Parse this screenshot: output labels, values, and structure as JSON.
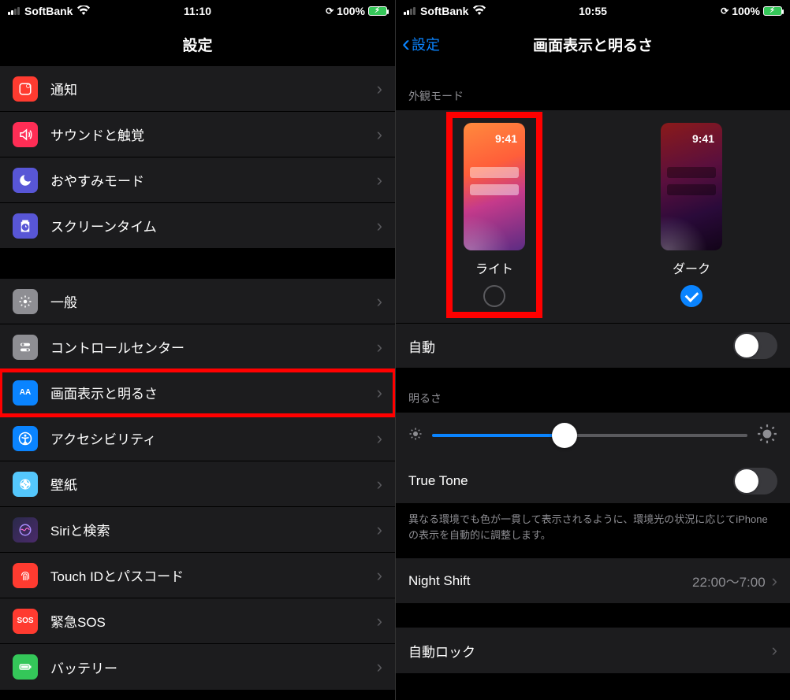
{
  "left": {
    "status": {
      "carrier": "SoftBank",
      "time": "11:10",
      "battery": "100%"
    },
    "title": "設定",
    "group1": [
      {
        "label": "通知"
      },
      {
        "label": "サウンドと触覚"
      },
      {
        "label": "おやすみモード"
      },
      {
        "label": "スクリーンタイム"
      }
    ],
    "group2": [
      {
        "label": "一般"
      },
      {
        "label": "コントロールセンター"
      },
      {
        "label": "画面表示と明るさ"
      },
      {
        "label": "アクセシビリティ"
      },
      {
        "label": "壁紙"
      },
      {
        "label": "Siriと検索"
      },
      {
        "label": "Touch IDとパスコード"
      },
      {
        "label": "緊急SOS"
      },
      {
        "label": "バッテリー"
      }
    ]
  },
  "right": {
    "status": {
      "carrier": "SoftBank",
      "time": "10:55",
      "battery": "100%"
    },
    "back": "設定",
    "title": "画面表示と明るさ",
    "appearance_header": "外観モード",
    "preview_time": "9:41",
    "light_label": "ライト",
    "dark_label": "ダーク",
    "auto_label": "自動",
    "brightness_header": "明るさ",
    "truetone_label": "True Tone",
    "truetone_desc": "異なる環境でも色が一貫して表示されるように、環境光の状況に応じてiPhoneの表示を自動的に調整します。",
    "nightshift_label": "Night Shift",
    "nightshift_detail": "22:00〜7:00",
    "autolock_label": "自動ロック"
  }
}
